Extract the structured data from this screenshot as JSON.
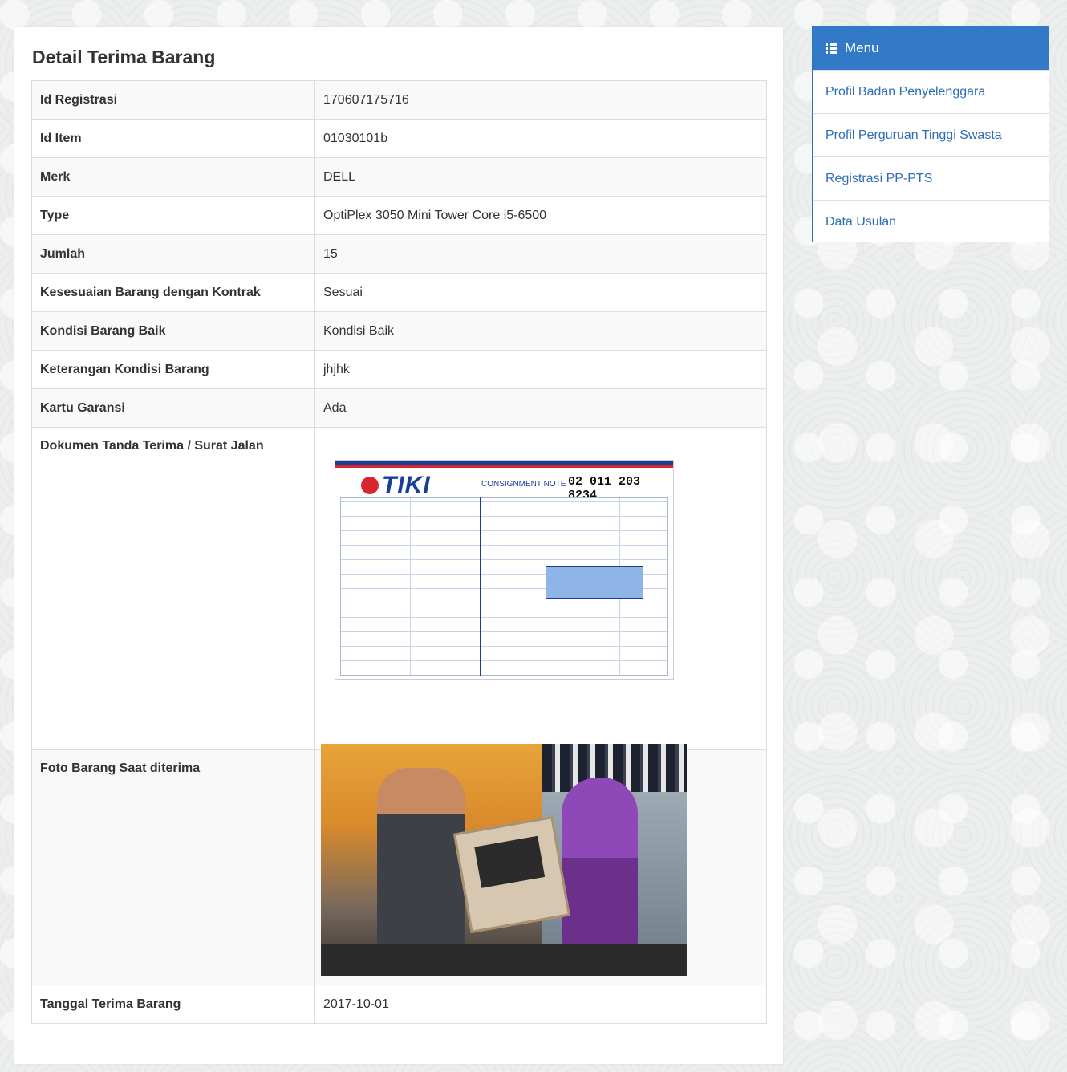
{
  "page_title": "Detail Terima Barang",
  "details": [
    {
      "label": "Id Registrasi",
      "value": "170607175716"
    },
    {
      "label": "Id Item",
      "value": "01030101b"
    },
    {
      "label": "Merk",
      "value": "DELL"
    },
    {
      "label": "Type",
      "value": "OptiPlex 3050 Mini Tower Core i5-6500"
    },
    {
      "label": "Jumlah",
      "value": "15"
    },
    {
      "label": "Kesesuaian Barang dengan Kontrak",
      "value": "Sesuai"
    },
    {
      "label": "Kondisi Barang Baik",
      "value": "Kondisi Baik"
    },
    {
      "label": "Keterangan Kondisi Barang",
      "value": "jhjhk"
    },
    {
      "label": "Kartu Garansi",
      "value": "Ada"
    },
    {
      "label": "Dokumen Tanda Terima / Surat Jalan"
    },
    {
      "label": "Foto Barang Saat diterima"
    },
    {
      "label": "Tanggal Terima Barang",
      "value": "2017-10-01"
    }
  ],
  "document_image": {
    "logo_text": "TIKI",
    "note_label": "CONSIGNMENT NOTE",
    "number": "02 011 203 8234"
  },
  "menu": {
    "title": "Menu",
    "icon": "list-icon",
    "items": [
      {
        "label": "Profil Badan Penyelenggara"
      },
      {
        "label": "Profil Perguruan Tinggi Swasta"
      },
      {
        "label": "Registrasi PP-PTS"
      },
      {
        "label": "Data Usulan"
      }
    ]
  },
  "colors": {
    "menu_header": "#3279c7",
    "menu_link": "#2f6db5",
    "row_stripe": "#f9f9f9",
    "border": "#dddddd"
  }
}
